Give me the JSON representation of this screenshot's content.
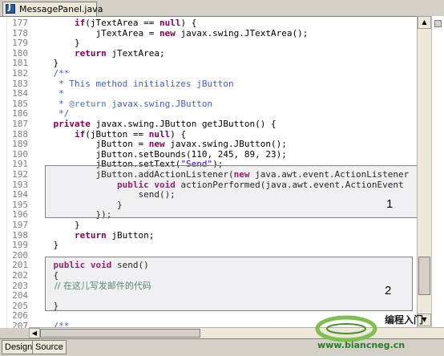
{
  "tab": {
    "title": "MessagePanel.java"
  },
  "code_lines": [
    {
      "n": "177",
      "text": "        if(jTextArea == null) {",
      "kind": "plain"
    },
    {
      "n": "178",
      "text": "            jTextArea = new javax.swing.JTextArea();",
      "kind": "plain"
    },
    {
      "n": "179",
      "text": "        }",
      "kind": "plain"
    },
    {
      "n": "180",
      "text": "        return jTextArea;",
      "kind": "plain"
    },
    {
      "n": "181",
      "text": "    }",
      "kind": "plain"
    },
    {
      "n": "182",
      "text": "    /**",
      "kind": "comment"
    },
    {
      "n": "183",
      "text": "     * This method initializes jButton",
      "kind": "comment"
    },
    {
      "n": "184",
      "text": "     *",
      "kind": "comment"
    },
    {
      "n": "185",
      "text": "     * @return javax.swing.JButton",
      "kind": "comment"
    },
    {
      "n": "186",
      "text": "     */",
      "kind": "comment"
    },
    {
      "n": "187",
      "text": "    private javax.swing.JButton getJButton() {",
      "kind": "plain"
    },
    {
      "n": "188",
      "text": "        if(jButton == null) {",
      "kind": "plain"
    },
    {
      "n": "189",
      "text": "            jButton = new javax.swing.JButton();",
      "kind": "plain"
    },
    {
      "n": "190",
      "text": "            jButton.setBounds(110, 245, 89, 23);",
      "kind": "plain"
    },
    {
      "n": "191",
      "text": "            jButton.setText(\"Send\");",
      "kind": "plain"
    },
    {
      "n": "192",
      "text": "            jButton.addActionListener(new java.awt.event.ActionListener",
      "kind": "plain"
    },
    {
      "n": "193",
      "text": "                public void actionPerformed(java.awt.event.ActionEvent",
      "kind": "plain"
    },
    {
      "n": "194",
      "text": "                    send();",
      "kind": "plain"
    },
    {
      "n": "195",
      "text": "                }",
      "kind": "plain"
    },
    {
      "n": "196",
      "text": "            });",
      "kind": "plain"
    },
    {
      "n": "197",
      "text": "        }",
      "kind": "plain"
    },
    {
      "n": "198",
      "text": "        return jButton;",
      "kind": "plain"
    },
    {
      "n": "199",
      "text": "    }",
      "kind": "plain"
    },
    {
      "n": "200",
      "text": "",
      "kind": "plain"
    },
    {
      "n": "201",
      "text": "    public void send()",
      "kind": "plain"
    },
    {
      "n": "202",
      "text": "    {",
      "kind": "plain"
    },
    {
      "n": "203",
      "text": "        // 在这儿写发邮件的代码",
      "kind": "zh"
    },
    {
      "n": "204",
      "text": "",
      "kind": "plain"
    },
    {
      "n": "205",
      "text": "    }",
      "kind": "plain"
    },
    {
      "n": "206",
      "text": "",
      "kind": "plain"
    },
    {
      "n": "207",
      "text": "    /**",
      "kind": "comment"
    }
  ],
  "annotations": {
    "box1_label": "1",
    "box2_label": "2"
  },
  "bottom_tabs": {
    "design": "Design",
    "source": "Source"
  },
  "watermark": {
    "title": "编程入门",
    "url": "www.biancneg.cn"
  },
  "colors": {
    "keyword": "#7f0055",
    "comment": "#3f5fbf",
    "string": "#2a00ff",
    "line_number": "#808080"
  }
}
